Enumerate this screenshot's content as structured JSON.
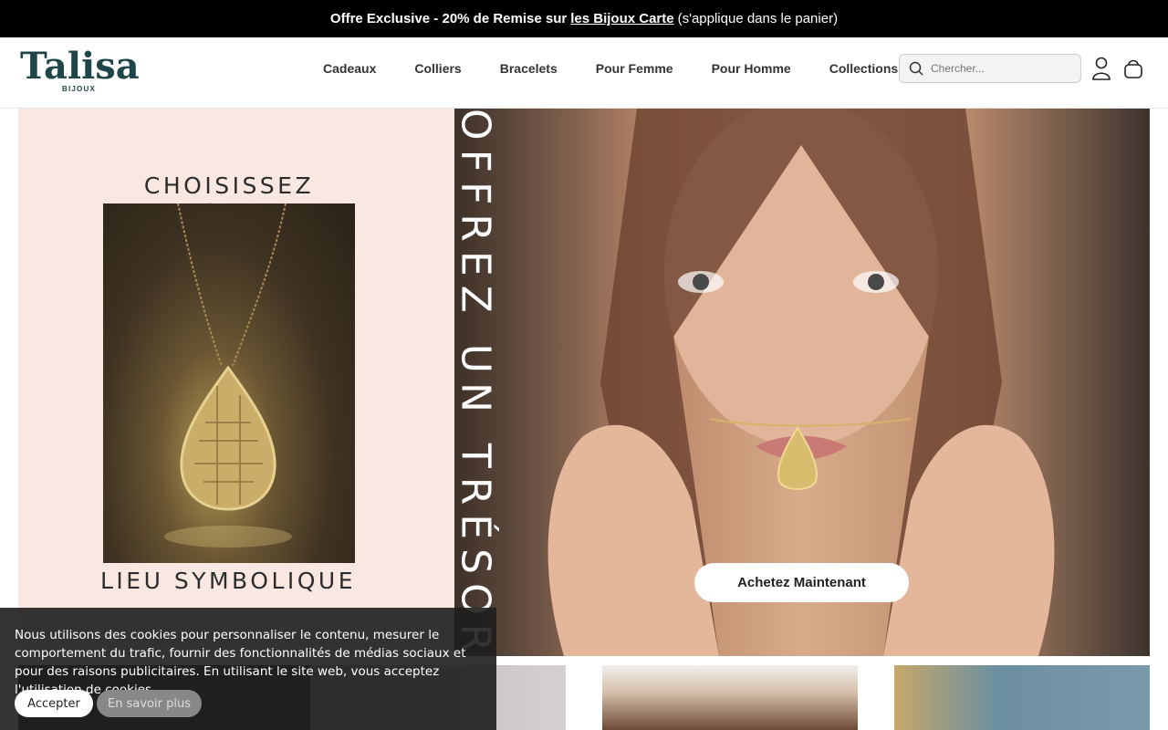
{
  "announcement": {
    "bold_prefix": "Offre Exclusive - 20% de Remise sur",
    "link": "les Bijoux Carte",
    "suffix": "(s'applique dans le panier)"
  },
  "header": {
    "logo_word": "Talisa",
    "logo_sub": "BIJOUX",
    "nav": [
      "Cadeaux",
      "Colliers",
      "Bracelets",
      "Pour Femme",
      "Pour Homme",
      "Collections"
    ],
    "search_placeholder": "Chercher..."
  },
  "hero": {
    "left_title": "CHOISISSEZ VOTRE",
    "left_bottom": "LIEU SYMBOLIQUE",
    "vertical_text": "OFFREZ UN TRÉSOR",
    "cta": "Achetez Maintenant"
  },
  "cookie": {
    "text": "Nous utilisons des cookies pour personnaliser le contenu, mesurer le comportement du trafic, fournir des fonctionnalités de médias sociaux et pour des raisons publicitaires. En utilisant le site web, vous acceptez l'utilisation de cookies.",
    "accept": "Accepter",
    "learn_more": "En savoir plus"
  },
  "colors": {
    "brand": "#1e4648",
    "hero_left_bg": "#f9e8e2",
    "announce_bg": "#000000"
  }
}
